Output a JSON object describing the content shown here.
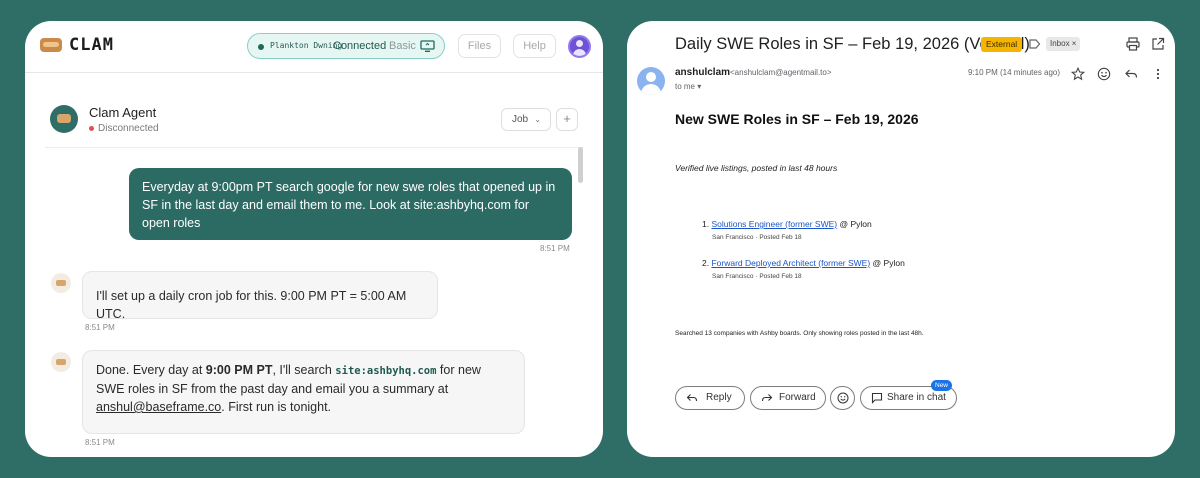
{
  "chat": {
    "app_name": "CLAM",
    "status": {
      "name": "Plankton Dwning",
      "connection": "Connected",
      "mode": "Basic"
    },
    "files_label": "Files",
    "help_label": "Help",
    "agent": {
      "name": "Clam Agent",
      "status": "Disconnected",
      "job_label": "Job",
      "plus_label": "+"
    },
    "messages": [
      {
        "role": "user",
        "text": "Everyday at 9:00pm PT search google for new swe roles that opened up in SF in the last day and email them to me. Look at site:ashbyhq.com for open roles",
        "time": "8:51 PM"
      },
      {
        "role": "agent",
        "text": "I'll set up a daily cron job for this. 9:00 PM PT = 5:00 AM UTC.",
        "time": "8:51 PM"
      },
      {
        "role": "agent",
        "parts": {
          "p1": "Done. Every day at ",
          "p2": "9:00 PM PT",
          "p3": ", I'll search ",
          "p4": "site:ashbyhq.com",
          "p5": " for new SWE roles in SF from the past day and email you a summary at ",
          "p6": "anshul@baseframe.co",
          "p7": ". First run is tonight."
        },
        "time": "8:51 PM"
      }
    ]
  },
  "mail": {
    "subject": "Daily SWE Roles in SF – Feb 19, 2026 (Verified)",
    "tag_external": "External",
    "tag_inbox": "Inbox ×",
    "sender_name": "anshulclam",
    "sender_email": "<anshulclam@agentmail.to>",
    "to": "to me ▾",
    "time": "9:10 PM (14 minutes ago)",
    "body_title": "New SWE Roles in SF – Feb 19, 2026",
    "body_subtitle": "Verified live listings, posted in last 48 hours",
    "jobs": [
      {
        "num": "1.",
        "title": "Solutions Engineer (former SWE)",
        "company": " @ Pylon",
        "meta": "San Francisco · Posted Feb 18"
      },
      {
        "num": "2.",
        "title": "Forward Deployed Architect (former SWE)",
        "company": " @ Pylon",
        "meta": "San Francisco · Posted Feb 18"
      }
    ],
    "footnote": "Searched 13 companies with Ashby boards. Only showing roles posted in the last 48h.",
    "buttons": {
      "reply": "Reply",
      "forward": "Forward",
      "share": "Share in chat",
      "new_badge": "New"
    },
    "colors": {
      "external_tag": "#f4b400",
      "link": "#1a55c9"
    }
  },
  "colors": {
    "background": "#2e6e67",
    "user_bubble": "#2c6b63",
    "accent_purple": "#6f52d6"
  }
}
